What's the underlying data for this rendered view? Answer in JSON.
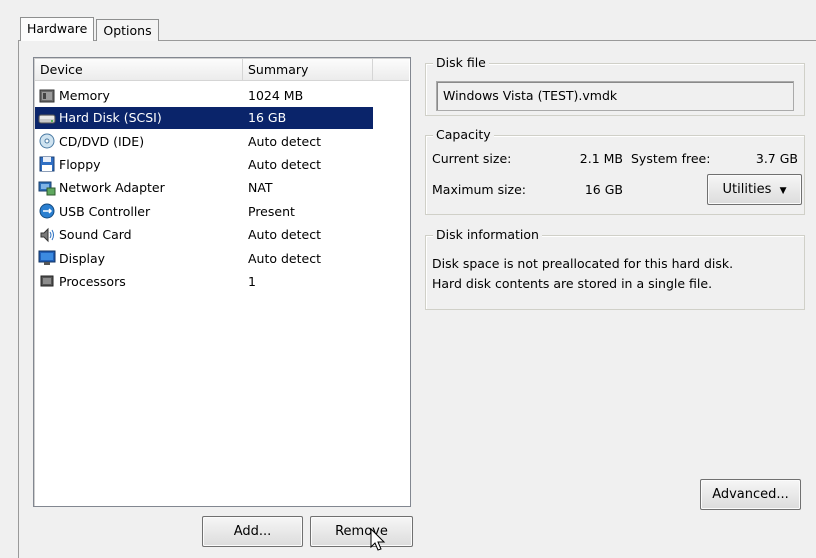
{
  "tabs": [
    {
      "label": "Hardware",
      "active": true
    },
    {
      "label": "Options",
      "active": false
    }
  ],
  "device_list": {
    "columns": [
      "Device",
      "Summary"
    ],
    "rows": [
      {
        "device": "Memory",
        "summary": "1024 MB",
        "icon": "memory-icon"
      },
      {
        "device": "Hard Disk (SCSI)",
        "summary": "16 GB",
        "icon": "hard-disk-icon",
        "selected": true
      },
      {
        "device": "CD/DVD (IDE)",
        "summary": "Auto detect",
        "icon": "cd-dvd-icon"
      },
      {
        "device": "Floppy",
        "summary": "Auto detect",
        "icon": "floppy-icon"
      },
      {
        "device": "Network Adapter",
        "summary": "NAT",
        "icon": "network-adapter-icon"
      },
      {
        "device": "USB Controller",
        "summary": "Present",
        "icon": "usb-icon"
      },
      {
        "device": "Sound Card",
        "summary": "Auto detect",
        "icon": "speaker-icon"
      },
      {
        "device": "Display",
        "summary": "Auto detect",
        "icon": "display-icon"
      },
      {
        "device": "Processors",
        "summary": "1",
        "icon": "processor-icon"
      }
    ]
  },
  "buttons": {
    "add": "Add...",
    "remove": "Remove",
    "utilities": "Utilities",
    "advanced": "Advanced..."
  },
  "disk_file": {
    "title": "Disk file",
    "value": "Windows Vista (TEST).vmdk"
  },
  "capacity": {
    "title": "Capacity",
    "current_label": "Current size:",
    "current_value": "2.1 MB",
    "system_free_label": "System free:",
    "system_free_value": "3.7 GB",
    "maximum_label": "Maximum size:",
    "maximum_value": "16 GB"
  },
  "disk_info": {
    "title": "Disk information",
    "lines": [
      "Disk space is not preallocated for this hard disk.",
      "Hard disk contents are stored in a single file."
    ]
  },
  "colors": {
    "selection": "#0a246a",
    "background": "#f0f0f0"
  }
}
